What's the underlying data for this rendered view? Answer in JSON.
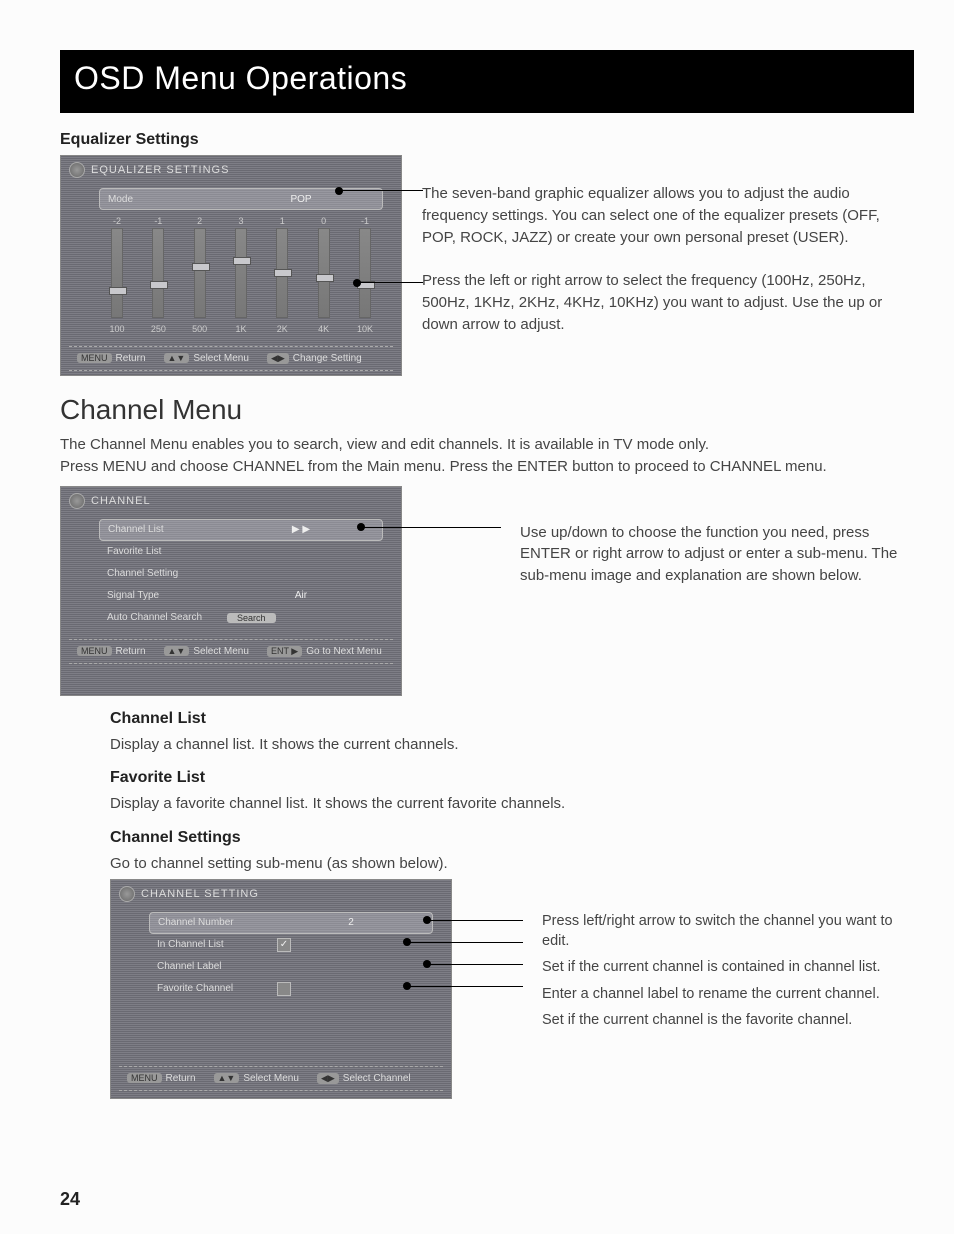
{
  "banner": "OSD Menu Operations",
  "eq": {
    "heading": "Equalizer Settings",
    "osd_title": "EQUALIZER SETTINGS",
    "mode_label": "Mode",
    "mode_value": "POP",
    "bands": [
      {
        "db": "-2",
        "freq": "100",
        "pos": 58
      },
      {
        "db": "-1",
        "freq": "250",
        "pos": 52
      },
      {
        "db": "2",
        "freq": "500",
        "pos": 34
      },
      {
        "db": "3",
        "freq": "1K",
        "pos": 28
      },
      {
        "db": "1",
        "freq": "2K",
        "pos": 40
      },
      {
        "db": "0",
        "freq": "4K",
        "pos": 45
      },
      {
        "db": "-1",
        "freq": "10K",
        "pos": 52
      }
    ],
    "footer": {
      "return_key": "MENU",
      "return": "Return",
      "select_key": "▲▼",
      "select": "Select Menu",
      "change_key": "◀▶",
      "change": "Change Setting"
    },
    "annot1": "The seven-band graphic equalizer allows you to adjust the audio frequency settings. You can select one of the equalizer presets (OFF, POP, ROCK, JAZZ) or create your own personal preset (USER).",
    "annot2": "Press the left or right arrow to select the frequency (100Hz, 250Hz, 500Hz, 1KHz, 2KHz, 4KHz, 10KHz) you want to adjust. Use the up or down arrow to adjust."
  },
  "channel": {
    "heading": "Channel Menu",
    "intro1": "The Channel Menu enables you to search, view and edit channels. It is available in TV mode only.",
    "intro2": "Press MENU and choose CHANNEL from the Main menu. Press the ENTER button to proceed to CHANNEL menu.",
    "osd_title": "CHANNEL",
    "rows": [
      {
        "label": "Channel List",
        "val": "▶ ▶",
        "sel": true
      },
      {
        "label": "Favorite List",
        "val": ""
      },
      {
        "label": "Channel Setting",
        "val": ""
      },
      {
        "label": "Signal Type",
        "val": "Air"
      },
      {
        "label": "Auto Channel Search",
        "val": "Search",
        "btn": true
      }
    ],
    "footer": {
      "return_key": "MENU",
      "return": "Return",
      "select_key": "▲▼",
      "select": "Select Menu",
      "next_key": "ENT ▶",
      "next": "Go to Next Menu"
    },
    "annot": "Use up/down to choose the function you need, press ENTER or right arrow to adjust or enter a sub-menu. The sub-menu image and explanation are shown below.",
    "sub": {
      "cl_h": "Channel List",
      "cl_t": "Display a channel list. It shows the current channels.",
      "fl_h": "Favorite List",
      "fl_t": "Display a favorite channel list. It shows the current favorite channels.",
      "cs_h": "Channel Settings",
      "cs_t": "Go to channel setting sub-menu (as shown below)."
    }
  },
  "chset": {
    "osd_title": "CHANNEL SETTING",
    "rows": [
      {
        "label": "Channel Number",
        "val": "2",
        "sel": true
      },
      {
        "label": "In Channel List",
        "check": true,
        "checked": true
      },
      {
        "label": "Channel Label",
        "val": ""
      },
      {
        "label": "Favorite Channel",
        "check": true,
        "checked": false
      }
    ],
    "footer": {
      "return_key": "MENU",
      "return": "Return",
      "select_key": "▲▼",
      "select": "Select Menu",
      "ch_key": "◀▶",
      "ch": "Select Channel"
    },
    "callouts": [
      "Press left/right arrow to switch the channel you want to edit.",
      "Set if the current channel is contained in channel list.",
      "Enter a channel label to rename the current channel.",
      "Set if the current channel is the favorite channel."
    ]
  },
  "page_number": "24"
}
